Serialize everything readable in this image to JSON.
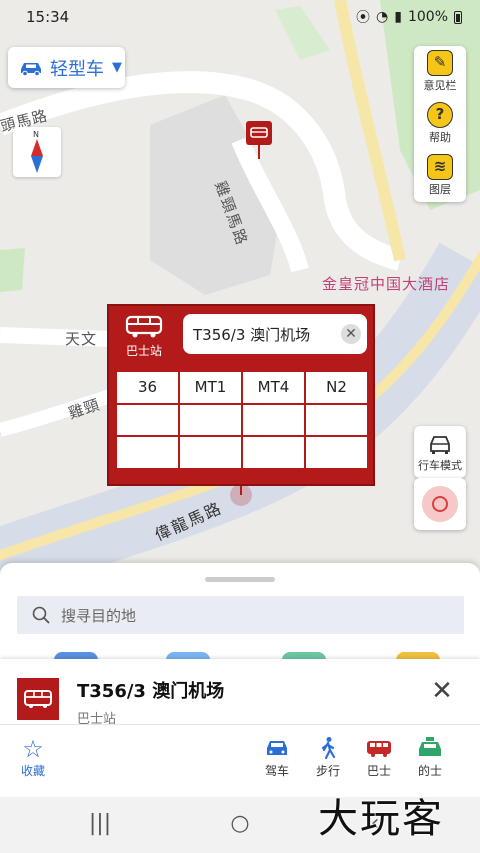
{
  "status": {
    "time": "15:34",
    "battery": "100%"
  },
  "vehicle": {
    "label": "轻型车"
  },
  "compass": {
    "north": "N"
  },
  "tools": {
    "feedback": "意见栏",
    "help": "帮助",
    "layers": "图层"
  },
  "map": {
    "hotel_label": "金皇冠中国大酒店",
    "road_labels": [
      "頭馬路",
      "雞頸馬路",
      "天文",
      "雞頸",
      "偉龍馬路"
    ]
  },
  "controls": {
    "drive_mode": "行车模式"
  },
  "popup": {
    "type_label": "巴士站",
    "stop_name": "T356/3 澳门机场",
    "routes": [
      "36",
      "MT1",
      "MT4",
      "N2",
      "",
      "",
      "",
      "",
      "",
      "",
      "",
      ""
    ]
  },
  "sheet": {
    "search_placeholder": "搜寻目的地"
  },
  "detail": {
    "title": "T356/3 澳门机场",
    "subtitle": "巴士站",
    "favorite_label": "收藏",
    "modes": [
      "驾车",
      "步行",
      "巴士",
      "的士"
    ]
  },
  "watermark": "大玩客",
  "colors": {
    "accent_blue": "#2b6fd6",
    "bus_red": "#b31b1b"
  }
}
